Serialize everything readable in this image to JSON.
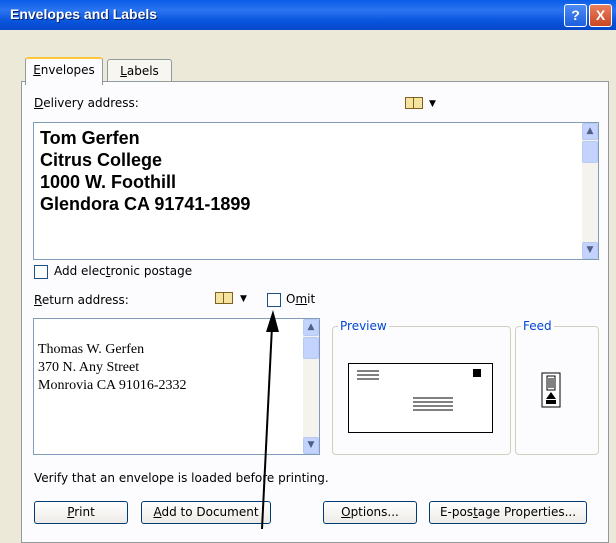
{
  "window": {
    "title": "Envelopes and Labels",
    "help": "?",
    "close": "X"
  },
  "tabs": [
    {
      "label_pre": "",
      "label_key": "E",
      "label_post": "nvelopes"
    },
    {
      "label_pre": "",
      "label_key": "L",
      "label_post": "abels"
    }
  ],
  "delivery": {
    "label_pre": "",
    "label_key": "D",
    "label_post": "elivery address:",
    "lines": [
      "Tom Gerfen",
      "Citrus College",
      "1000 W. Foothill",
      "Glendora CA 91741-1899"
    ]
  },
  "postage": {
    "label_pre": "Add elec",
    "label_key": "t",
    "label_post": "ronic postage"
  },
  "return_addr": {
    "label_pre": "",
    "label_key": "R",
    "label_post": "eturn address:",
    "omit_pre": "O",
    "omit_key": "m",
    "omit_post": "it",
    "lines": [
      "Thomas W. Gerfen",
      "370 N. Any Street",
      "Monrovia CA 91016-2332"
    ]
  },
  "preview": {
    "title": "Preview"
  },
  "feed": {
    "title": "Feed"
  },
  "verify_text": "Verify that an envelope is loaded before printing.",
  "buttons": {
    "print_key": "P",
    "print_post": "rint",
    "add_key": "A",
    "add_post": "dd to Document",
    "options_key": "O",
    "options_post": "ptions...",
    "epostage_pre": "E-pos",
    "epostage_key": "t",
    "epostage_post": "age Properties..."
  }
}
